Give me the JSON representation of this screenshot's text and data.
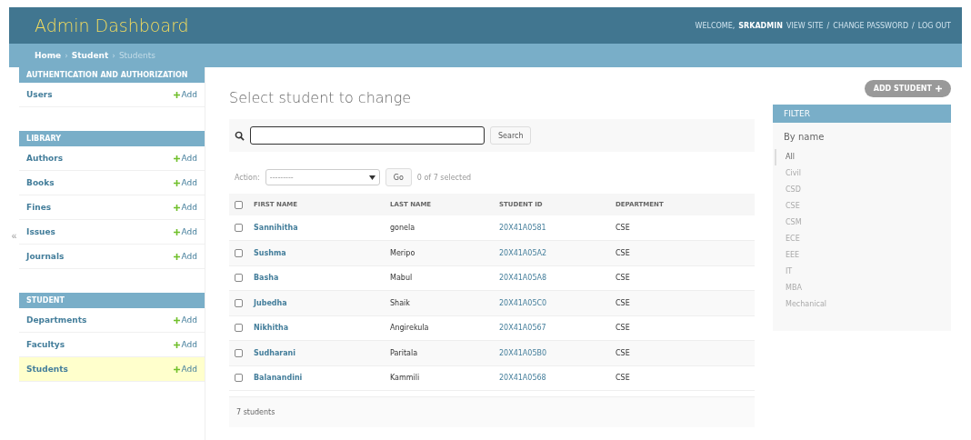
{
  "header": {
    "title": "Admin Dashboard",
    "welcome": "WELCOME,",
    "user": "SRKADMIN",
    "links": [
      "VIEW SITE",
      "CHANGE PASSWORD",
      "LOG OUT"
    ],
    "separator": "/"
  },
  "breadcrumbs": [
    {
      "label": "Home",
      "current": false
    },
    {
      "label": "Student",
      "current": false
    },
    {
      "label": "Students",
      "current": true
    }
  ],
  "breadcrumb_separator": "›",
  "collapse_toggle": "«",
  "sidebar": [
    {
      "title": "AUTHENTICATION AND AUTHORIZATION",
      "items": [
        {
          "label": "Users",
          "add": "Add",
          "selected": false
        }
      ]
    },
    {
      "title": "LIBRARY",
      "items": [
        {
          "label": "Authors",
          "add": "Add",
          "selected": false
        },
        {
          "label": "Books",
          "add": "Add",
          "selected": false
        },
        {
          "label": "Fines",
          "add": "Add",
          "selected": false
        },
        {
          "label": "Issues",
          "add": "Add",
          "selected": false
        },
        {
          "label": "Journals",
          "add": "Add",
          "selected": false
        }
      ]
    },
    {
      "title": "STUDENT",
      "items": [
        {
          "label": "Departments",
          "add": "Add",
          "selected": false
        },
        {
          "label": "Facultys",
          "add": "Add",
          "selected": false
        },
        {
          "label": "Students",
          "add": "Add",
          "selected": true
        }
      ]
    }
  ],
  "content": {
    "title": "Select student to change",
    "add_button": "ADD STUDENT",
    "search_button": "Search",
    "action_label": "Action:",
    "action_value": "---------",
    "go_button": "Go",
    "selection_count": "0 of 7 selected",
    "footer": "7 students"
  },
  "table": {
    "all_checked": false,
    "columns": [
      "FIRST NAME",
      "LAST NAME",
      "STUDENT ID",
      "DEPARTMENT"
    ],
    "rows": [
      {
        "first": "Sannihitha",
        "last": "gonela",
        "id": "20X41A0581",
        "dept": "CSE",
        "checked": false
      },
      {
        "first": "Sushma",
        "last": "Meripo",
        "id": "20X41A05A2",
        "dept": "CSE",
        "checked": false
      },
      {
        "first": "Basha",
        "last": "Mabul",
        "id": "20X41A05A8",
        "dept": "CSE",
        "checked": false
      },
      {
        "first": "Jubedha",
        "last": "Shaik",
        "id": "20X41A05C0",
        "dept": "CSE",
        "checked": false
      },
      {
        "first": "Nikhitha",
        "last": "Angirekula",
        "id": "20X41A0567",
        "dept": "CSE",
        "checked": false
      },
      {
        "first": "Sudharani",
        "last": "Paritala",
        "id": "20X41A05B0",
        "dept": "CSE",
        "checked": false
      },
      {
        "first": "Balanandini",
        "last": "Kammili",
        "id": "20X41A0568",
        "dept": "CSE",
        "checked": false
      }
    ]
  },
  "filter": {
    "title": "FILTER",
    "subtitle": "By name",
    "options": [
      {
        "label": "All",
        "selected": true
      },
      {
        "label": "Civil",
        "selected": false
      },
      {
        "label": "CSD",
        "selected": false
      },
      {
        "label": "CSE",
        "selected": false
      },
      {
        "label": "CSM",
        "selected": false
      },
      {
        "label": "ECE",
        "selected": false
      },
      {
        "label": "EEE",
        "selected": false
      },
      {
        "label": "IT",
        "selected": false
      },
      {
        "label": "MBA",
        "selected": false
      },
      {
        "label": "Mechanical",
        "selected": false
      }
    ]
  }
}
